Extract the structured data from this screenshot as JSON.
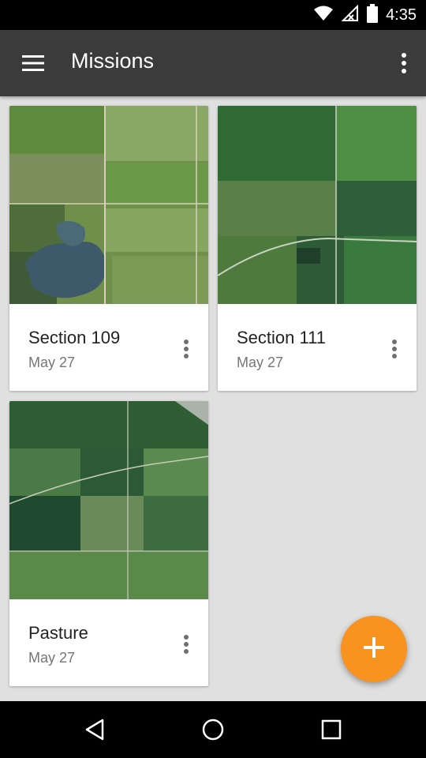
{
  "status_bar": {
    "time": "4:35",
    "icons": [
      "wifi-icon",
      "signal-off-icon",
      "battery-icon"
    ]
  },
  "app_bar": {
    "title": "Missions",
    "menu_icon": "hamburger-menu-icon",
    "overflow_icon": "more-vert-icon"
  },
  "missions": [
    {
      "name": "Section 109",
      "date": "May 27"
    },
    {
      "name": "Section 111",
      "date": "May 27"
    },
    {
      "name": "Pasture",
      "date": "May 27"
    }
  ],
  "fab": {
    "icon": "add-icon",
    "color": "#f7931e"
  },
  "colors": {
    "app_bar": "#3b3b3b",
    "background": "#e0e0e0",
    "accent": "#f7931e"
  },
  "nav_bar": {
    "icons": [
      "back-icon",
      "home-icon",
      "recents-icon"
    ]
  }
}
